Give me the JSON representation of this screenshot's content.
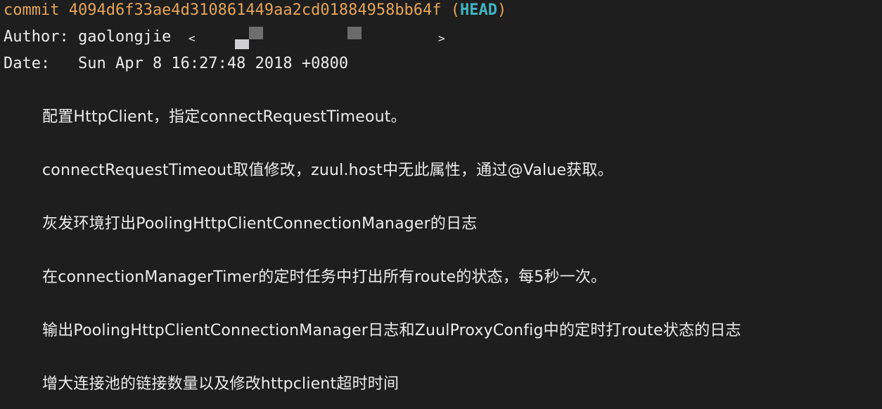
{
  "commit": {
    "keyword": "commit",
    "hash": "4094d6f33ae4d310861449aa2cd01884958bb64f",
    "ref_open": "(",
    "ref": "HEAD",
    "ref_close": ")"
  },
  "author": {
    "label": "Author:",
    "name": "gaolongjie",
    "email_open": "<",
    "email_close": ">"
  },
  "date": {
    "label": "Date:",
    "value": "Sun Apr 8 16:27:48 2018 +0800"
  },
  "message_lines": [
    "配置HttpClient，指定connectRequestTimeout。",
    "connectRequestTimeout取值修改，zuul.host中无此属性，通过@Value获取。",
    "灰发环境打出PoolingHttpClientConnectionManager的日志",
    "在connectionManagerTimer的定时任务中打出所有route的状态，每5秒一次。",
    "输出PoolingHttpClientConnectionManager日志和ZuulProxyConfig中的定时打route状态的日志",
    "增大连接池的链接数量以及修改httpclient超时时间"
  ],
  "colors": {
    "background": "#1e1e1e",
    "text": "#ececec",
    "commit_hash": "#e5a55b",
    "head_ref": "#3fb6c2"
  }
}
